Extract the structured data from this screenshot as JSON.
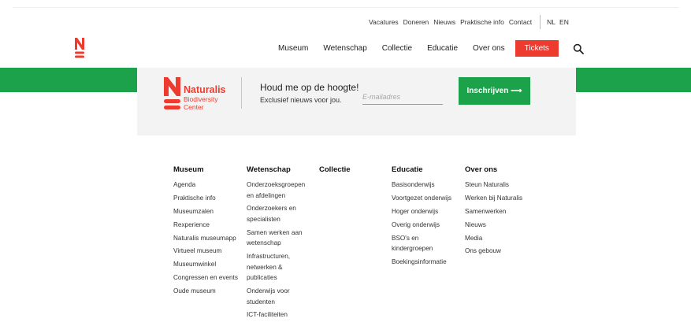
{
  "utility": {
    "links": [
      "Vacatures",
      "Doneren",
      "Nieuws",
      "Praktische info",
      "Contact"
    ],
    "languages": [
      "NL",
      "EN"
    ]
  },
  "nav": {
    "items": [
      "Museum",
      "Wetenschap",
      "Collectie",
      "Educatie",
      "Over ons"
    ],
    "tickets": "Tickets"
  },
  "newsletter": {
    "brand": "Naturalis",
    "brand_sub": [
      "Biodiversity",
      "Center"
    ],
    "title": "Houd me op de hoogte!",
    "subtitle": "Exclusief nieuws voor jou.",
    "email_placeholder": "E-mailadres",
    "button": "Inschrijven ⟶"
  },
  "footer": {
    "columns": [
      {
        "title": "Museum",
        "links": [
          "Agenda",
          "Praktische info",
          "Museumzalen",
          "Rexperience",
          "Naturalis museumapp",
          "Virtueel museum",
          "Museumwinkel",
          "Congressen en events",
          "Oude museum"
        ]
      },
      {
        "title": "Wetenschap",
        "links": [
          "Onderzoeksgroepen en afdelingen",
          "Onderzoekers en specialisten",
          "Samen werken aan wetenschap",
          "Infrastructuren, netwerken & publicaties",
          "Onderwijs voor studenten",
          "ICT-faciliteiten"
        ]
      },
      {
        "title": "Collectie",
        "links": []
      },
      {
        "title": "Educatie",
        "links": [
          "Basisonderwijs",
          "Voortgezet onderwijs",
          "Hoger onderwijs",
          "Overig onderwijs",
          "BSO's en kindergroepen",
          "Boekingsinformatie"
        ]
      },
      {
        "title": "Over ons",
        "links": [
          "Steun Naturalis",
          "Werken bij Naturalis",
          "Samenwerken",
          "Nieuws",
          "Media",
          "Ons gebouw"
        ]
      }
    ]
  },
  "colors": {
    "brand_red": "#ee3b2f",
    "green": "#1ba24a",
    "card_bg": "#f3f3f3"
  },
  "icons": [
    "naturalis-logo-icon",
    "search-icon"
  ]
}
